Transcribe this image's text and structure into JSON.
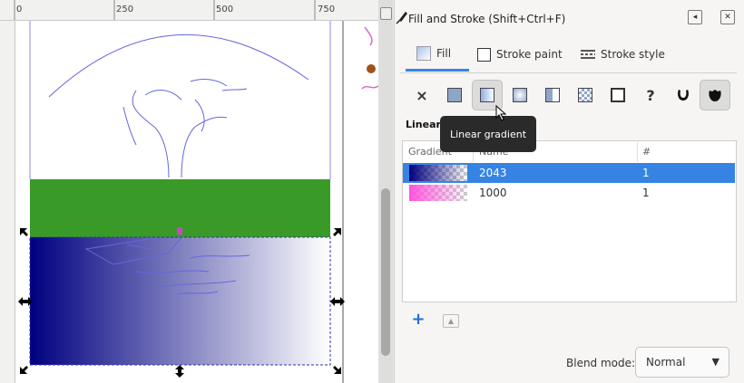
{
  "ruler": {
    "ticks": [
      "0",
      "250",
      "500",
      "750"
    ]
  },
  "dialog": {
    "title": "Fill and Stroke (Shift+Ctrl+F)",
    "tabs": [
      {
        "label": "Fill",
        "icon": "fill-swatch-icon",
        "active": true
      },
      {
        "label": "Stroke paint",
        "icon": "stroke-paint-icon",
        "active": false
      },
      {
        "label": "Stroke style",
        "icon": "stroke-style-icon",
        "active": false
      }
    ],
    "fill_modes": [
      {
        "icon": "no-paint-icon",
        "glyph": "×"
      },
      {
        "icon": "flat-color-icon"
      },
      {
        "icon": "linear-gradient-icon",
        "selected": true
      },
      {
        "icon": "radial-gradient-icon"
      },
      {
        "icon": "mesh-gradient-icon"
      },
      {
        "icon": "pattern-icon"
      },
      {
        "icon": "swatch-icon"
      },
      {
        "icon": "unset-paint-icon",
        "glyph": "?"
      },
      {
        "icon": "fill-rule-evenodd-icon"
      },
      {
        "icon": "fill-rule-nonzero-icon"
      }
    ],
    "section_label": "Linear gradient",
    "tooltip": "Linear gradient",
    "table": {
      "headers": [
        "Gradient",
        "Name",
        "#"
      ],
      "rows": [
        {
          "name": "2043",
          "count": "1",
          "from": "#000080",
          "selected": true
        },
        {
          "name": "1000",
          "count": "1",
          "from": "#ff55dd",
          "selected": false
        }
      ]
    },
    "blend": {
      "label": "Blend mode:",
      "value": "Normal"
    }
  },
  "colors": {
    "accent": "#3584e4",
    "grass": "#3a9a28",
    "water": "#000080",
    "sketch": "#6666dd"
  }
}
